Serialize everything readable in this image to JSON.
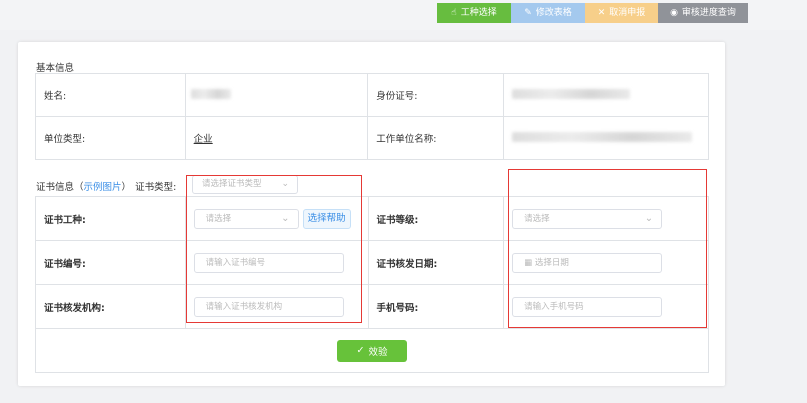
{
  "toolbar": {
    "select_label": "工种选择",
    "edit_label": "修改表格",
    "cancel_label": "取消申报",
    "progress_label": "审核进度查询"
  },
  "basic": {
    "title": "基本信息",
    "name_label": "姓名:",
    "id_label": "身份证号:",
    "unit_type_label": "单位类型:",
    "unit_type_value": "企业",
    "work_unit_label": "工作单位名称:"
  },
  "cert": {
    "title": "证书信息",
    "example_link": "示例图片",
    "paren_open": "（",
    "paren_close": "）",
    "type_label": "证书类型:",
    "type_placeholder": "请选择证书类型",
    "work_type_label": "证书工种:",
    "work_type_placeholder": "请选择",
    "help_label": "选择帮助",
    "level_label": "证书等级:",
    "level_placeholder": "请选择",
    "number_label": "证书编号:",
    "number_placeholder": "请输入证书编号",
    "issue_date_label": "证书核发日期:",
    "issue_date_placeholder": "选择日期",
    "issuer_label": "证书核发机构:",
    "issuer_placeholder": "请输入证书核发机构",
    "phone_label": "手机号码:",
    "phone_placeholder": "请输入手机号码",
    "verify_label": "效验"
  },
  "colors": {
    "primary_green": "#67bd3f",
    "edit_blue": "#a4c9ee",
    "cancel_orange": "#f7cf8a",
    "progress_gray": "#909399",
    "highlight_red": "#e53935",
    "link_blue": "#3a8ee6"
  },
  "icons": {
    "select": "hand-pointer-icon",
    "edit": "pencil-icon",
    "cancel": "close-icon",
    "progress": "eye-icon",
    "chevron": "chevron-down-icon",
    "calendar": "calendar-icon",
    "check": "check-icon"
  }
}
